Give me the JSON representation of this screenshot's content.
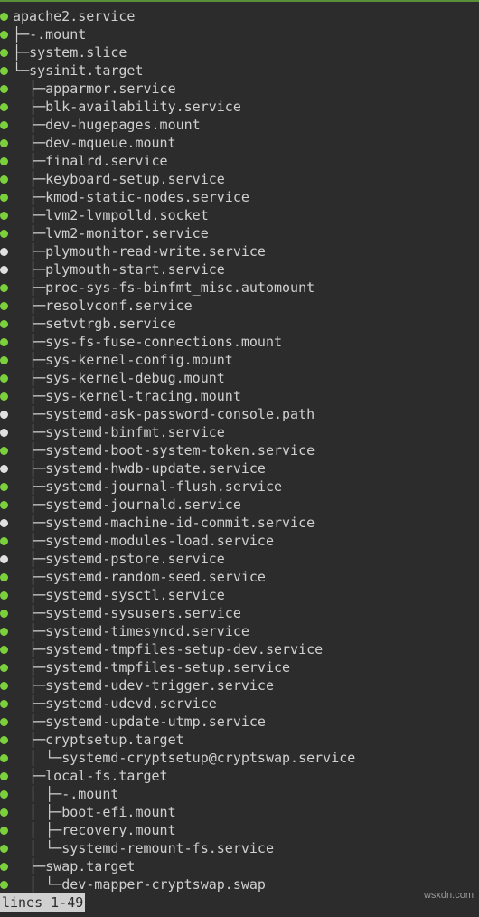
{
  "root": {
    "name": "apache2.service",
    "status": "green"
  },
  "tree": [
    {
      "depth": 1,
      "last": false,
      "status": "green",
      "name": "-.mount"
    },
    {
      "depth": 1,
      "last": false,
      "status": "green",
      "name": "system.slice"
    },
    {
      "depth": 1,
      "last": true,
      "status": "green",
      "name": "sysinit.target"
    },
    {
      "depth": 2,
      "last": false,
      "status": "green",
      "name": "apparmor.service"
    },
    {
      "depth": 2,
      "last": false,
      "status": "green",
      "name": "blk-availability.service"
    },
    {
      "depth": 2,
      "last": false,
      "status": "green",
      "name": "dev-hugepages.mount"
    },
    {
      "depth": 2,
      "last": false,
      "status": "green",
      "name": "dev-mqueue.mount"
    },
    {
      "depth": 2,
      "last": false,
      "status": "green",
      "name": "finalrd.service"
    },
    {
      "depth": 2,
      "last": false,
      "status": "green",
      "name": "keyboard-setup.service"
    },
    {
      "depth": 2,
      "last": false,
      "status": "green",
      "name": "kmod-static-nodes.service"
    },
    {
      "depth": 2,
      "last": false,
      "status": "green",
      "name": "lvm2-lvmpolld.socket"
    },
    {
      "depth": 2,
      "last": false,
      "status": "green",
      "name": "lvm2-monitor.service"
    },
    {
      "depth": 2,
      "last": false,
      "status": "white",
      "name": "plymouth-read-write.service"
    },
    {
      "depth": 2,
      "last": false,
      "status": "white",
      "name": "plymouth-start.service"
    },
    {
      "depth": 2,
      "last": false,
      "status": "green",
      "name": "proc-sys-fs-binfmt_misc.automount"
    },
    {
      "depth": 2,
      "last": false,
      "status": "green",
      "name": "resolvconf.service"
    },
    {
      "depth": 2,
      "last": false,
      "status": "green",
      "name": "setvtrgb.service"
    },
    {
      "depth": 2,
      "last": false,
      "status": "green",
      "name": "sys-fs-fuse-connections.mount"
    },
    {
      "depth": 2,
      "last": false,
      "status": "green",
      "name": "sys-kernel-config.mount"
    },
    {
      "depth": 2,
      "last": false,
      "status": "green",
      "name": "sys-kernel-debug.mount"
    },
    {
      "depth": 2,
      "last": false,
      "status": "green",
      "name": "sys-kernel-tracing.mount"
    },
    {
      "depth": 2,
      "last": false,
      "status": "white",
      "name": "systemd-ask-password-console.path"
    },
    {
      "depth": 2,
      "last": false,
      "status": "white",
      "name": "systemd-binfmt.service"
    },
    {
      "depth": 2,
      "last": false,
      "status": "green",
      "name": "systemd-boot-system-token.service"
    },
    {
      "depth": 2,
      "last": false,
      "status": "white",
      "name": "systemd-hwdb-update.service"
    },
    {
      "depth": 2,
      "last": false,
      "status": "green",
      "name": "systemd-journal-flush.service"
    },
    {
      "depth": 2,
      "last": false,
      "status": "green",
      "name": "systemd-journald.service"
    },
    {
      "depth": 2,
      "last": false,
      "status": "white",
      "name": "systemd-machine-id-commit.service"
    },
    {
      "depth": 2,
      "last": false,
      "status": "green",
      "name": "systemd-modules-load.service"
    },
    {
      "depth": 2,
      "last": false,
      "status": "white",
      "name": "systemd-pstore.service"
    },
    {
      "depth": 2,
      "last": false,
      "status": "green",
      "name": "systemd-random-seed.service"
    },
    {
      "depth": 2,
      "last": false,
      "status": "green",
      "name": "systemd-sysctl.service"
    },
    {
      "depth": 2,
      "last": false,
      "status": "green",
      "name": "systemd-sysusers.service"
    },
    {
      "depth": 2,
      "last": false,
      "status": "green",
      "name": "systemd-timesyncd.service"
    },
    {
      "depth": 2,
      "last": false,
      "status": "green",
      "name": "systemd-tmpfiles-setup-dev.service"
    },
    {
      "depth": 2,
      "last": false,
      "status": "green",
      "name": "systemd-tmpfiles-setup.service"
    },
    {
      "depth": 2,
      "last": false,
      "status": "green",
      "name": "systemd-udev-trigger.service"
    },
    {
      "depth": 2,
      "last": false,
      "status": "green",
      "name": "systemd-udevd.service"
    },
    {
      "depth": 2,
      "last": false,
      "status": "green",
      "name": "systemd-update-utmp.service"
    },
    {
      "depth": 2,
      "last": false,
      "status": "green",
      "name": "cryptsetup.target"
    },
    {
      "depth": 3,
      "last": true,
      "status": "green",
      "name": "systemd-cryptsetup@cryptswap.service",
      "parent_open": [
        false,
        true
      ]
    },
    {
      "depth": 2,
      "last": false,
      "status": "green",
      "name": "local-fs.target"
    },
    {
      "depth": 3,
      "last": false,
      "status": "green",
      "name": "-.mount",
      "parent_open": [
        false,
        true
      ]
    },
    {
      "depth": 3,
      "last": false,
      "status": "green",
      "name": "boot-efi.mount",
      "parent_open": [
        false,
        true
      ]
    },
    {
      "depth": 3,
      "last": false,
      "status": "green",
      "name": "recovery.mount",
      "parent_open": [
        false,
        true
      ]
    },
    {
      "depth": 3,
      "last": true,
      "status": "green",
      "name": "systemd-remount-fs.service",
      "parent_open": [
        false,
        true
      ]
    },
    {
      "depth": 2,
      "last": false,
      "status": "green",
      "name": "swap.target"
    },
    {
      "depth": 3,
      "last": true,
      "status": "green",
      "name": "dev-mapper-cryptswap.swap",
      "parent_open": [
        false,
        true
      ]
    }
  ],
  "status_line": "lines 1-49",
  "watermark": "wsxdn.com"
}
